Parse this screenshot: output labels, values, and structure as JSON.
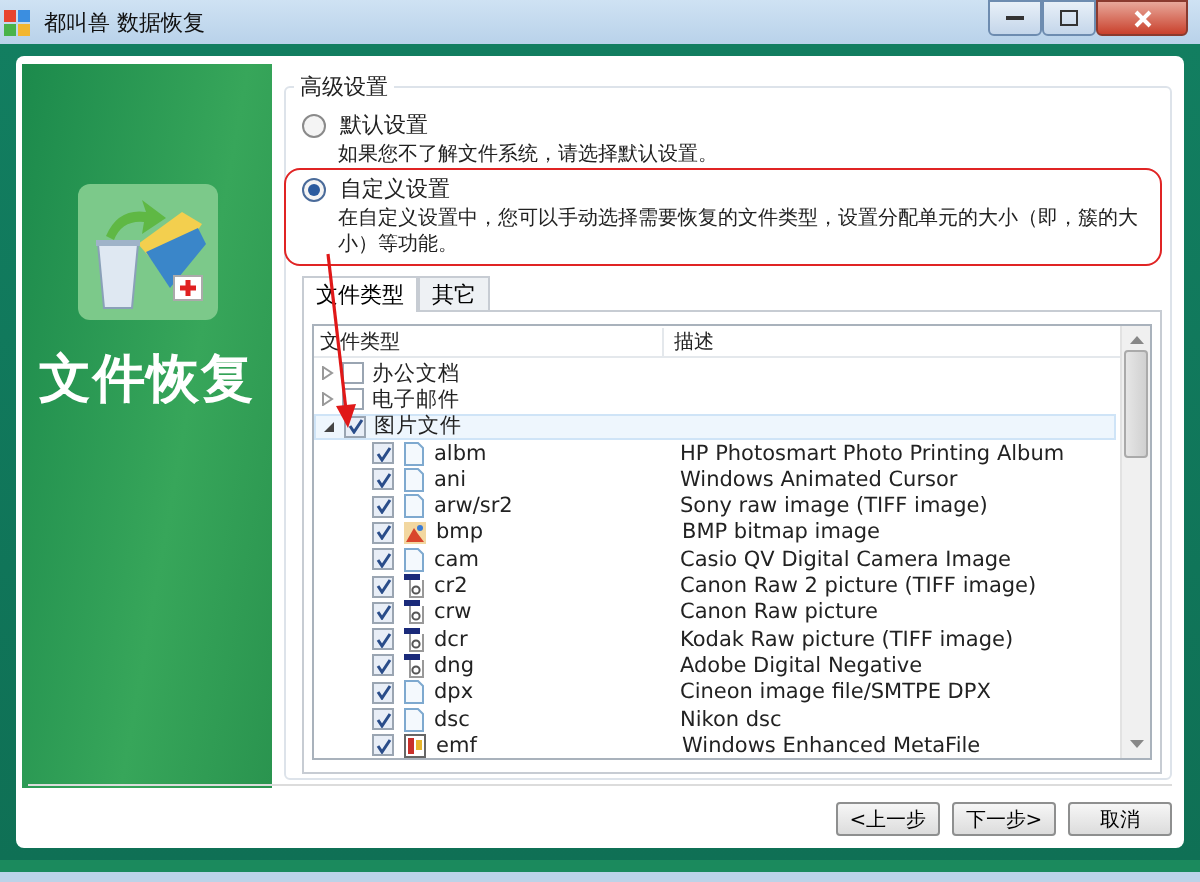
{
  "window": {
    "title": "都叫兽 数据恢复"
  },
  "sidebar": {
    "title": "文件恢复"
  },
  "settings": {
    "legend": "高级设置",
    "options": [
      {
        "label": "默认设置",
        "description": "如果您不了解文件系统，请选择默认设置。",
        "selected": false
      },
      {
        "label": "自定义设置",
        "description": "在自定义设置中，您可以手动选择需要恢复的文件类型，设置分配单元的大小（即，簇的大小）等功能。",
        "selected": true
      }
    ]
  },
  "tabs": [
    {
      "label": "文件类型",
      "selected": true
    },
    {
      "label": "其它",
      "selected": false
    }
  ],
  "file_tree": {
    "columns": [
      "文件类型",
      "描述"
    ],
    "items": [
      {
        "name": "办公文档",
        "checked": false,
        "expanded": false,
        "selected": false
      },
      {
        "name": "电子邮件",
        "checked": false,
        "expanded": false,
        "selected": false
      },
      {
        "name": "图片文件",
        "checked": true,
        "expanded": true,
        "selected": true,
        "children": [
          {
            "name": "albm",
            "description": "HP Photosmart Photo Printing Album",
            "checked": true,
            "kind": "document"
          },
          {
            "name": "ani",
            "description": "Windows Animated Cursor",
            "checked": true,
            "kind": "document"
          },
          {
            "name": "arw/sr2",
            "description": "Sony raw image (TIFF image)",
            "checked": true,
            "kind": "document"
          },
          {
            "name": "bmp",
            "description": "BMP bitmap image",
            "checked": true,
            "kind": "paint"
          },
          {
            "name": "cam",
            "description": "Casio QV Digital Camera Image",
            "checked": true,
            "kind": "document"
          },
          {
            "name": "cr2",
            "description": "Canon Raw 2 picture (TIFF image)",
            "checked": true,
            "kind": "raw"
          },
          {
            "name": "crw",
            "description": "Canon Raw picture",
            "checked": true,
            "kind": "raw"
          },
          {
            "name": "dcr",
            "description": "Kodak Raw picture (TIFF image)",
            "checked": true,
            "kind": "raw"
          },
          {
            "name": "dng",
            "description": "Adobe Digital Negative",
            "checked": true,
            "kind": "raw"
          },
          {
            "name": "dpx",
            "description": "Cineon image file/SMTPE DPX",
            "checked": true,
            "kind": "document"
          },
          {
            "name": "dsc",
            "description": "Nikon dsc",
            "checked": true,
            "kind": "document"
          },
          {
            "name": "emf",
            "description": "Windows Enhanced MetaFile",
            "checked": true,
            "kind": "metafile"
          }
        ]
      }
    ]
  },
  "buttons": [
    "<上一步",
    "下一步>",
    "取消"
  ]
}
